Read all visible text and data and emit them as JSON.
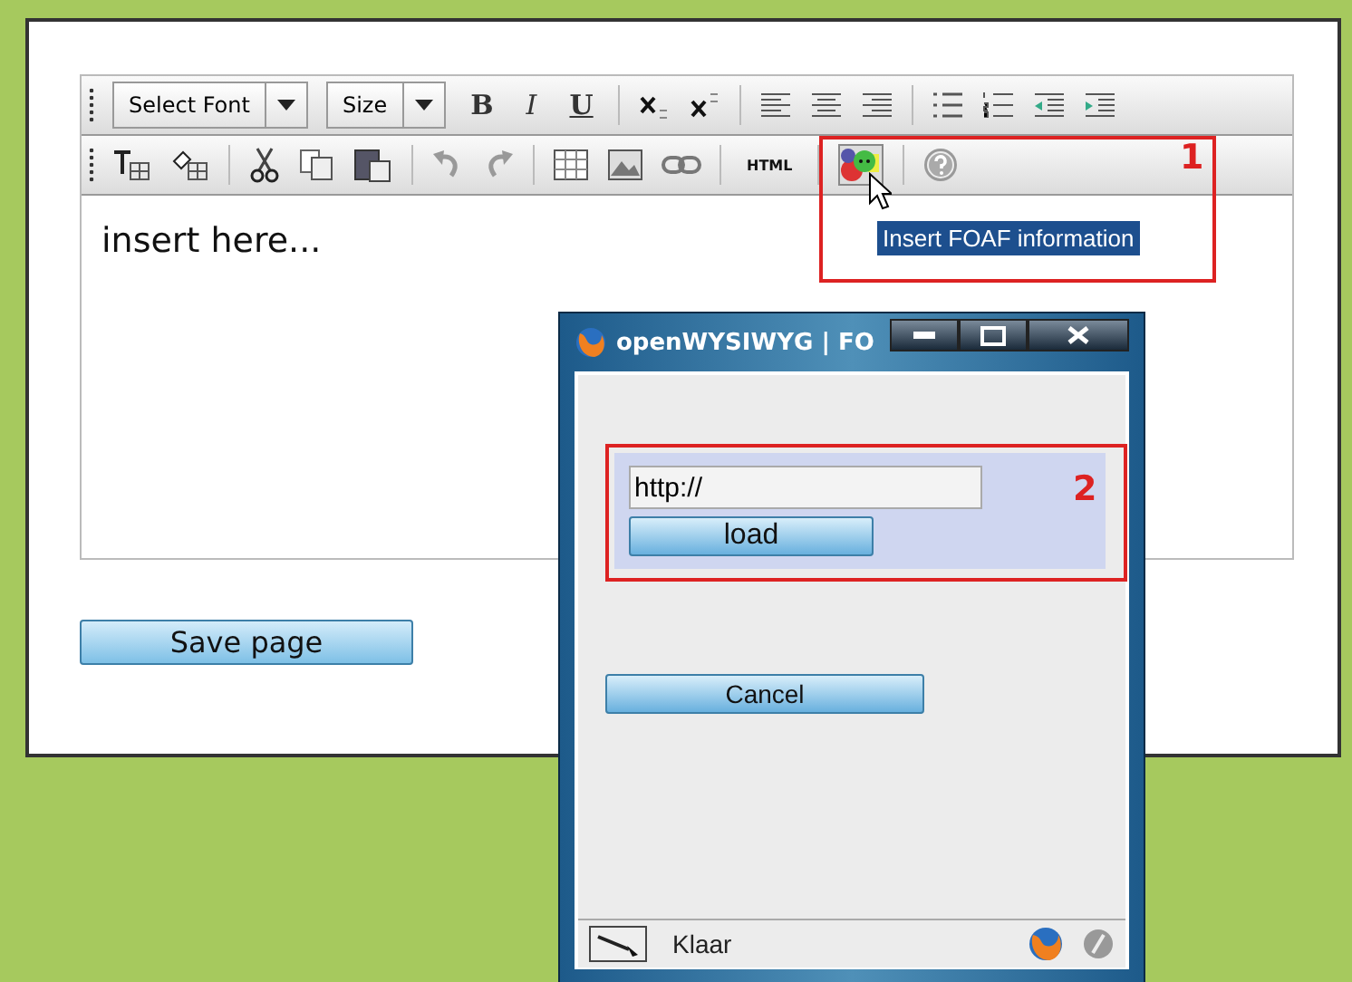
{
  "toolbar": {
    "font_select": "Select Font",
    "size_select": "Size",
    "bold": "B",
    "italic": "I",
    "underline": "U",
    "html_button": "HTML",
    "foaf_button": {
      "hovered": true
    },
    "tooltip": "Insert FOAF information"
  },
  "editor": {
    "content": "insert here..."
  },
  "save_button": "Save page",
  "annotations": [
    {
      "label": "1"
    },
    {
      "label": "2"
    }
  ],
  "popup": {
    "title": "openWYSIWYG | FO",
    "url_field": {
      "value": "http://"
    },
    "load_button": "load",
    "cancel_button": "Cancel",
    "status": "Klaar"
  }
}
